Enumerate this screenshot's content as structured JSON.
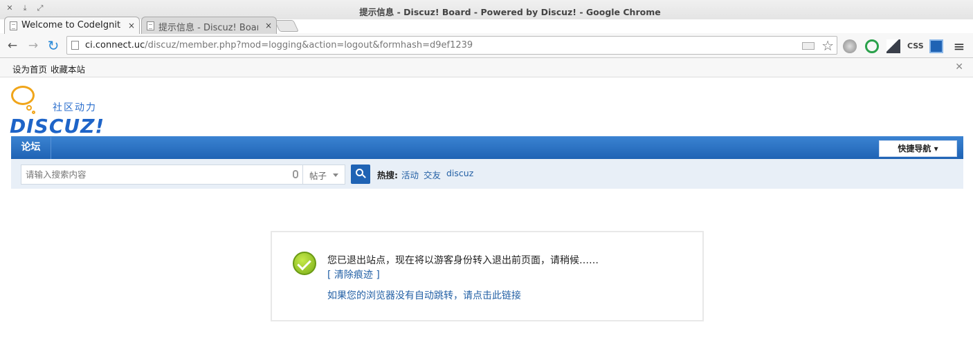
{
  "window": {
    "title": "提示信息 - Discuz! Board - Powered by Discuz! - Google Chrome"
  },
  "tabs": [
    {
      "label": "Welcome to CodeIgniter",
      "close": "×"
    },
    {
      "label": "提示信息 - Discuz! Board",
      "close": "×"
    }
  ],
  "toolbar": {
    "back": "←",
    "forward": "→",
    "reload": "↻",
    "url_host": "ci.connect.uc",
    "url_rest": "/discuz/member.php?mod=logging&action=logout&formhash=d9ef1239",
    "star": "☆",
    "extensions": [
      "globe-icon",
      "anti-virus-icon",
      "reader-icon",
      "css-icon",
      "screen-capture-icon",
      "menu-icon"
    ],
    "css_label": "CSS",
    "menu_glyph": "≡"
  },
  "bookmarks": {
    "items": [
      "设为首页",
      "收藏本站"
    ],
    "close": "✕"
  },
  "logo": {
    "slogan": "社区动力",
    "wordmark": "DISCUZ!"
  },
  "nav": {
    "forum": "论坛",
    "quicknav": "快捷导航 ▾"
  },
  "search": {
    "placeholder": "请输入搜索内容",
    "type": "帖子",
    "hot_label": "热搜:",
    "hot_links": [
      "活动",
      "交友",
      "discuz"
    ]
  },
  "message": {
    "text": "您已退出站点，现在将以游客身份转入退出前页面，请稍候……",
    "clear": "[ 清除痕迹 ]",
    "redirect": "如果您的浏览器没有自动跳转，请点击此链接"
  }
}
